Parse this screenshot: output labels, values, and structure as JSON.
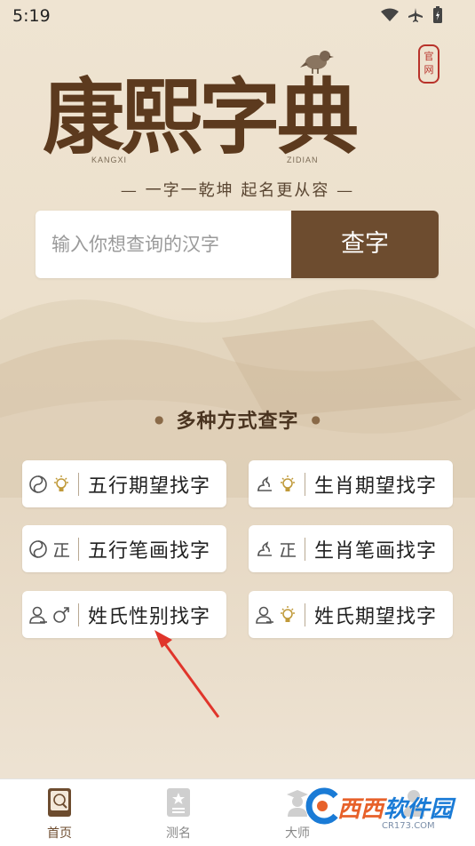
{
  "status_bar": {
    "time": "5:19"
  },
  "logo": {
    "title": "康熙字典",
    "pinyin_left": "KANGXI",
    "pinyin_right": "ZIDIAN",
    "seal": "官网"
  },
  "slogan": "— 一字一乾坤 起名更从容 —",
  "search": {
    "placeholder": "输入你想查询的汉字",
    "button": "查字"
  },
  "section": {
    "title": "多种方式查字"
  },
  "methods": [
    {
      "label": "五行期望找字",
      "icons": [
        "wuxing-icon",
        "lightbulb-icon"
      ]
    },
    {
      "label": "生肖期望找字",
      "icons": [
        "zodiac-icon",
        "lightbulb-icon"
      ]
    },
    {
      "label": "五行笔画找字",
      "icons": [
        "wuxing-icon",
        "stroke-icon"
      ]
    },
    {
      "label": "生肖笔画找字",
      "icons": [
        "zodiac-icon",
        "stroke-icon"
      ]
    },
    {
      "label": "姓氏性别找字",
      "icons": [
        "person-icon",
        "male-icon"
      ]
    },
    {
      "label": "姓氏期望找字",
      "icons": [
        "person-icon",
        "lightbulb-icon"
      ]
    }
  ],
  "tabs": [
    {
      "label": "首页",
      "icon": "dictionary-icon",
      "active": true
    },
    {
      "label": "测名",
      "icon": "star-card-icon",
      "active": false
    },
    {
      "label": "大师",
      "icon": "master-icon",
      "active": false
    }
  ],
  "watermark": {
    "text_a": "西西",
    "text_b": "软件园",
    "sub": "CR173.COM"
  },
  "colors": {
    "brown": "#6d4c2f",
    "background": "#ece0cc",
    "seal_red": "#b8322a",
    "arrow_red": "#e0352b"
  }
}
